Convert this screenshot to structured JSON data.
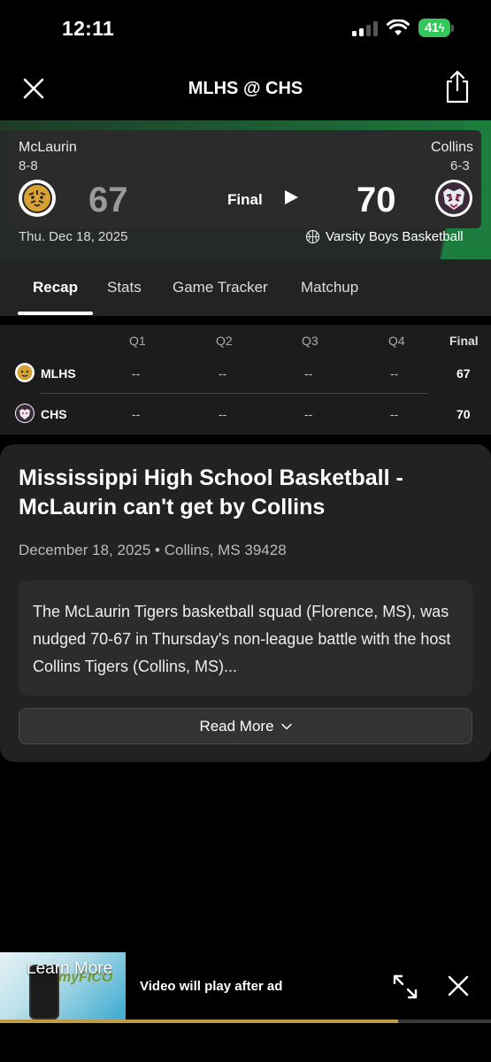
{
  "status_bar": {
    "time": "12:11",
    "battery": "41"
  },
  "header": {
    "title": "MLHS @ CHS"
  },
  "scorecard": {
    "away": {
      "name": "McLaurin",
      "record": "8-8",
      "score": "67"
    },
    "home": {
      "name": "Collins",
      "record": "6-3",
      "score": "70"
    },
    "status": "Final",
    "date": "Thu. Dec 18, 2025",
    "game_type": "Varsity Boys Basketball"
  },
  "tabs": [
    "Recap",
    "Stats",
    "Game Tracker",
    "Matchup"
  ],
  "linescore": {
    "headers": [
      "Q1",
      "Q2",
      "Q3",
      "Q4",
      "Final"
    ],
    "rows": [
      {
        "team": "MLHS",
        "quarters": [
          "--",
          "--",
          "--",
          "--"
        ],
        "final": "67"
      },
      {
        "team": "CHS",
        "quarters": [
          "--",
          "--",
          "--",
          "--"
        ],
        "final": "70"
      }
    ]
  },
  "article": {
    "title": "Mississippi High School Basketball - McLaurin can't get by Collins",
    "meta": "December 18, 2025 • Collins, MS 39428",
    "summary": "The McLaurin Tigers basketball squad (Florence, MS), was nudged 70-67 in Thursday's non-league battle with the host Collins Tigers (Collins, MS)...",
    "read_more": "Read More"
  },
  "ad": {
    "learn_more": "Learn More",
    "brand": "myFICO",
    "message": "Video will play after ad",
    "progress": 0.81
  },
  "colors": {
    "accent_green": "#1c7d3e",
    "battery_green": "#34c759",
    "ad_progress": "#c29a4c"
  }
}
